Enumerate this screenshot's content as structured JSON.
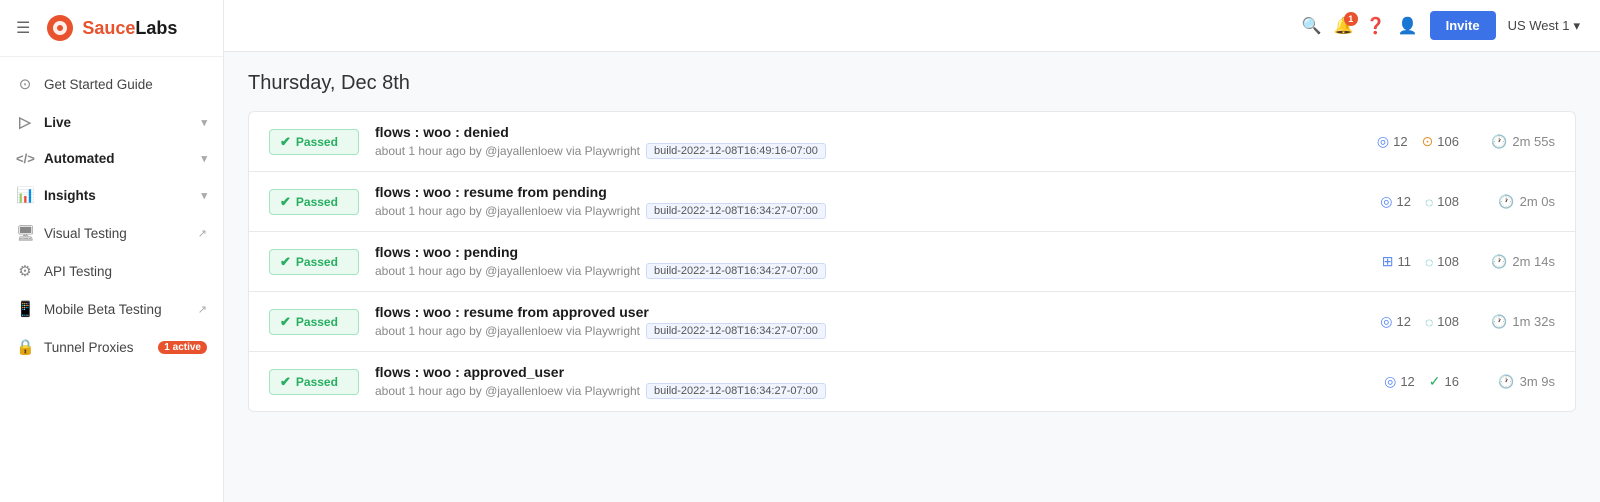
{
  "sidebar": {
    "logo_sauce": "Sauce",
    "logo_labs": "Labs",
    "items": [
      {
        "id": "get-started",
        "label": "Get Started Guide",
        "icon": "🚀",
        "badge": null,
        "chevron": false,
        "external": false
      },
      {
        "id": "live",
        "label": "Live",
        "icon": "▷",
        "badge": null,
        "chevron": true,
        "external": false
      },
      {
        "id": "automated",
        "label": "Automated",
        "icon": "</>",
        "badge": null,
        "chevron": true,
        "external": false
      },
      {
        "id": "insights",
        "label": "Insights",
        "icon": "📊",
        "badge": null,
        "chevron": true,
        "external": false
      },
      {
        "id": "visual-testing",
        "label": "Visual Testing",
        "icon": "🖥",
        "badge": null,
        "chevron": false,
        "external": true
      },
      {
        "id": "api-testing",
        "label": "API Testing",
        "icon": "⚙",
        "badge": null,
        "chevron": false,
        "external": false
      },
      {
        "id": "mobile-beta",
        "label": "Mobile Beta Testing",
        "icon": "📱",
        "badge": null,
        "chevron": false,
        "external": true
      },
      {
        "id": "tunnel-proxies",
        "label": "Tunnel Proxies",
        "icon": "🔒",
        "badge": "1 active",
        "chevron": false,
        "external": false
      }
    ]
  },
  "topbar": {
    "notification_count": "1",
    "invite_label": "Invite",
    "region_label": "US West 1"
  },
  "main": {
    "date_label": "Thursday, Dec 8th",
    "tests": [
      {
        "status": "Passed",
        "name": "flows : woo : denied",
        "meta": "about 1 hour ago by @jayallenloew via Playwright",
        "build": "build-2022-12-08T16:49:16-07:00",
        "stat1_count": "12",
        "stat1_type": "circle",
        "stat2_count": "106",
        "stat2_type": "spinner",
        "duration": "2m 55s"
      },
      {
        "status": "Passed",
        "name": "flows : woo : resume from pending",
        "meta": "about 1 hour ago by @jayallenloew via Playwright",
        "build": "build-2022-12-08T16:34:27-07:00",
        "stat1_count": "12",
        "stat1_type": "circle",
        "stat2_count": "108",
        "stat2_type": "spinner2",
        "duration": "2m 0s"
      },
      {
        "status": "Passed",
        "name": "flows : woo : pending",
        "meta": "about 1 hour ago by @jayallenloew via Playwright",
        "build": "build-2022-12-08T16:34:27-07:00",
        "stat1_count": "11",
        "stat1_type": "grid",
        "stat2_count": "108",
        "stat2_type": "spinner2",
        "duration": "2m 14s"
      },
      {
        "status": "Passed",
        "name": "flows : woo : resume from approved user",
        "meta": "about 1 hour ago by @jayallenloew via Playwright",
        "build": "build-2022-12-08T16:34:27-07:00",
        "stat1_count": "12",
        "stat1_type": "circle",
        "stat2_count": "108",
        "stat2_type": "spinner2",
        "duration": "1m 32s"
      },
      {
        "status": "Passed",
        "name": "flows : woo : approved_user",
        "meta": "about 1 hour ago by @jayallenloew via Playwright",
        "build": "build-2022-12-08T16:34:27-07:00",
        "stat1_count": "12",
        "stat1_type": "circle",
        "stat2_count": "16",
        "stat2_type": "check-circle",
        "duration": "3m 9s"
      }
    ]
  }
}
